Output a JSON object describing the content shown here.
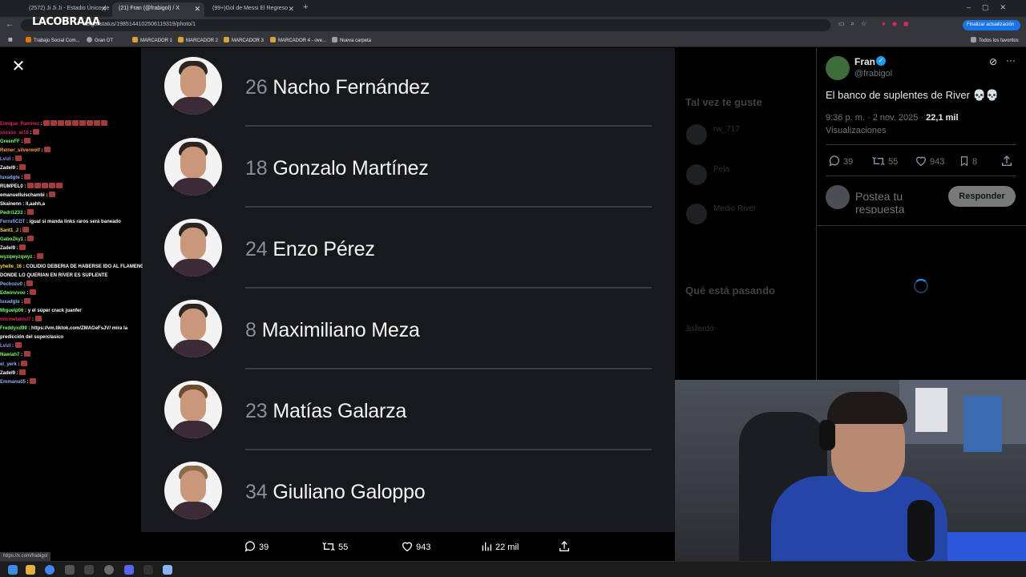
{
  "browser": {
    "tabs": [
      {
        "label": "(2572) Ji Ji Ji - Estadio Único de",
        "active": false
      },
      {
        "label": "(21) Fran (@frabigol) / X",
        "active": true
      },
      {
        "label": "(99+)Gol de Messi El Regreso",
        "active": false
      }
    ],
    "channel_overlay": "LACOBRAAA",
    "url": "abigol/status/1985144102506119319/photo/1",
    "update_button": "Finalizar actualización",
    "bookmarks": [
      {
        "label": "Trabajo Social Com...",
        "color": "#e37400"
      },
      {
        "label": "Gran DT",
        "color": "#9aa0a6"
      },
      {
        "label": "MARCADOR 1",
        "color": "#d8a23a"
      },
      {
        "label": "MARCADOR 2",
        "color": "#d8a23a"
      },
      {
        "label": "MARCADOR 3",
        "color": "#d8a23a"
      },
      {
        "label": "MARCADOR 4 - ove...",
        "color": "#d8a23a"
      },
      {
        "label": "Nueva carpeta",
        "color": "#9aa0a6"
      }
    ],
    "all_bookmarks": "Todos los favoritos",
    "status_url": "https://x.com/frabigol"
  },
  "chat": [
    {
      "user": "Enrique_Ramirez",
      "color": "#e0245e",
      "msg": "",
      "emotes": 9
    },
    {
      "user": "ssssss_ar10",
      "color": "#e0245e",
      "msg": "",
      "emotes": 1
    },
    {
      "user": "GreenFF",
      "color": "#7cfc6b",
      "msg": "",
      "emotes": 1
    },
    {
      "user": "Reiner_silverwolf",
      "color": "#ff9f43",
      "msg": "",
      "emotes": 1
    },
    {
      "user": "Lvizl",
      "color": "#b388ff",
      "msg": "",
      "emotes": 1
    },
    {
      "user": "Zadel9",
      "color": "#ffffff",
      "msg": "",
      "emotes": 1
    },
    {
      "user": "luxadgte",
      "color": "#8ab4f8",
      "msg": "",
      "emotes": 1
    },
    {
      "user": "RUMPEL0",
      "color": "#ffffff",
      "msg": "",
      "emotes": 5
    },
    {
      "user": "emanuelluischambi",
      "color": "#ffffff",
      "msg": "",
      "emotes": 1
    },
    {
      "user": "Skainenn",
      "color": "#ffffff",
      "msg": "ll,aahh,a",
      "emotes": 0
    },
    {
      "user": "Pedri1233",
      "color": "#7cfc6b",
      "msg": "",
      "emotes": 1
    },
    {
      "user": "FerrufiCDT",
      "color": "#8ab4f8",
      "msg": "igual si manda links raros será baneado",
      "emotes": 0
    },
    {
      "user": "Sant1_J",
      "color": "#ffd54f",
      "msg": "",
      "emotes": 1
    },
    {
      "user": "GaboZky1",
      "color": "#7cfc6b",
      "msg": "",
      "emotes": 1
    },
    {
      "user": "Zadel9",
      "color": "#ffffff",
      "msg": "",
      "emotes": 1
    },
    {
      "user": "wyzqwyzqwyz",
      "color": "#7cfc6b",
      "msg": "",
      "emotes": 1
    },
    {
      "user": "yhelle_16",
      "color": "#ffd54f",
      "msg": "COLIDIO DEBERIA DE HABERSE IDO AL FLAMENGO",
      "emotes": 0
    },
    {
      "user": "",
      "color": "#ffffff",
      "msg": "DONDE LO QUERIAN EN RIVER ES SUPLENTE",
      "emotes": 0
    },
    {
      "user": "Pechozu0",
      "color": "#8ab4f8",
      "msg": "",
      "emotes": 1
    },
    {
      "user": "Edwinvvoo",
      "color": "#7cfc6b",
      "msg": "",
      "emotes": 1
    },
    {
      "user": "luxadgte",
      "color": "#8ab4f8",
      "msg": "",
      "emotes": 1
    },
    {
      "user": "Miguelp06",
      "color": "#7cfc6b",
      "msg": "y el súper crack juanfer",
      "emotes": 0
    },
    {
      "user": "mtcmetanisl7",
      "color": "#e0245e",
      "msg": "",
      "emotes": 1
    },
    {
      "user": "Freddyxd99",
      "color": "#7cfc6b",
      "msg": "https://vm.tiktok.com/ZMAGeFsJV/ mira la",
      "emotes": 0
    },
    {
      "user": "",
      "color": "#ffffff",
      "msg": "predicción del superclasico",
      "emotes": 0
    },
    {
      "user": "Lvizl",
      "color": "#b388ff",
      "msg": "",
      "emotes": 1
    },
    {
      "user": "Nawiah7",
      "color": "#7cfc6b",
      "msg": "",
      "emotes": 1
    },
    {
      "user": "el_yerk",
      "color": "#8ab4f8",
      "msg": "",
      "emotes": 1
    },
    {
      "user": "Zadel9",
      "color": "#ffffff",
      "msg": "",
      "emotes": 1
    },
    {
      "user": "Emmanu05",
      "color": "#8ab4f8",
      "msg": "",
      "emotes": 1
    }
  ],
  "players": [
    {
      "number": "26",
      "name": "Nacho Fernández"
    },
    {
      "number": "18",
      "name": "Gonzalo Martínez"
    },
    {
      "number": "24",
      "name": "Enzo Pérez"
    },
    {
      "number": "8",
      "name": "Maximiliano Meza"
    },
    {
      "number": "23",
      "name": "Matías Galarza"
    },
    {
      "number": "34",
      "name": "Giuliano Galoppo"
    }
  ],
  "viewer_actions": {
    "replies": "39",
    "reposts": "55",
    "likes": "943",
    "views": "22 mil"
  },
  "background_feed": {
    "section1": "Tal vez te guste",
    "accounts": [
      "rw_717",
      "Pela",
      "Medio River"
    ],
    "section2": "Qué está pasando",
    "trend": "3allardo"
  },
  "tweet": {
    "author_name": "Fran",
    "author_handle": "@frabigol",
    "text": "El banco de suplentes de River 💀💀",
    "time": "9:36 p. m. · 2 nov. 2025 · ",
    "views_count": "22,1 mil",
    "views_label": "Visualizaciones",
    "replies": "39",
    "reposts": "55",
    "likes": "943",
    "bookmarks": "8",
    "reply_placeholder": "Postea tu respuesta",
    "reply_button": "Responder"
  },
  "colors": {
    "accent": "#1d9bf0",
    "panel_bg": "#17191c"
  }
}
